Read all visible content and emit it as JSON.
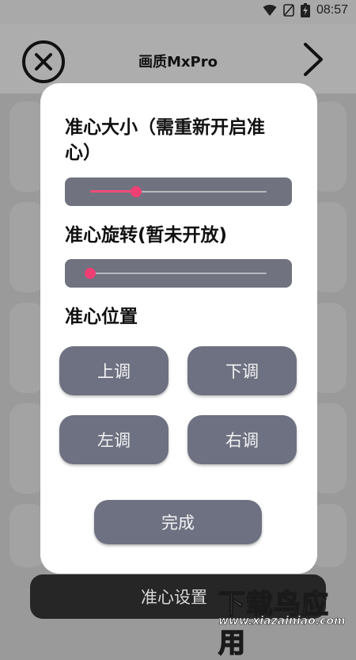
{
  "status_bar": {
    "time": "08:57"
  },
  "header": {
    "title": "画质MxPro"
  },
  "dialog": {
    "size_label": "准心大小（需重新开启准",
    "size_label_cont": "心）",
    "size_value": 0.26,
    "rotate_label": "准心旋转(暂未开放)",
    "rotate_value": 0.0,
    "position_label": "准心位置",
    "buttons": {
      "up": "上调",
      "down": "下调",
      "left": "左调",
      "right": "右调"
    },
    "done": "完成"
  },
  "bottom_bar": {
    "label": "准心设置"
  },
  "watermark": {
    "main": "下载鸟应用",
    "url": "www.xiazainiao.com"
  },
  "colors": {
    "accent": "#ef3f74",
    "button": "#6e7181",
    "overlay": "#9a9a9a"
  }
}
